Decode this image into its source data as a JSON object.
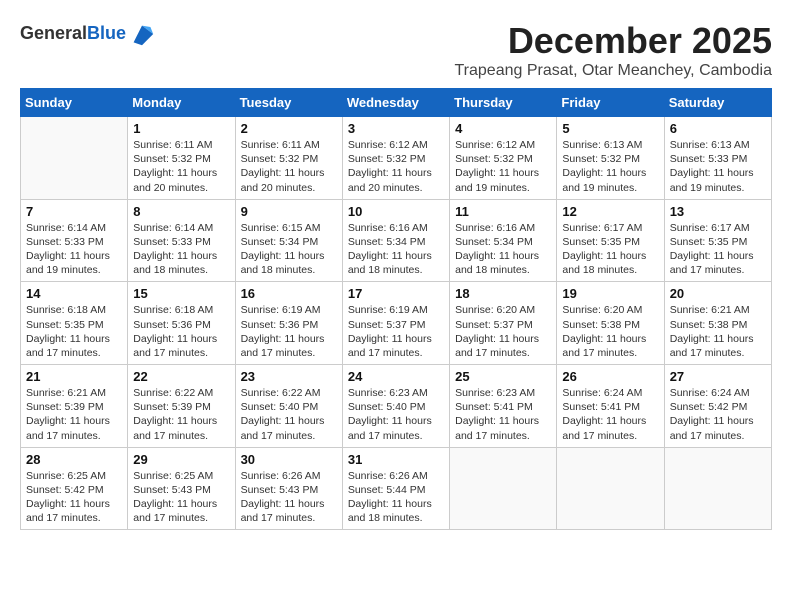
{
  "header": {
    "logo_general": "General",
    "logo_blue": "Blue",
    "month_title": "December 2025",
    "location": "Trapeang Prasat, Otar Meanchey, Cambodia"
  },
  "weekdays": [
    "Sunday",
    "Monday",
    "Tuesday",
    "Wednesday",
    "Thursday",
    "Friday",
    "Saturday"
  ],
  "weeks": [
    [
      {
        "day": "",
        "info": ""
      },
      {
        "day": "1",
        "info": "Sunrise: 6:11 AM\nSunset: 5:32 PM\nDaylight: 11 hours\nand 20 minutes."
      },
      {
        "day": "2",
        "info": "Sunrise: 6:11 AM\nSunset: 5:32 PM\nDaylight: 11 hours\nand 20 minutes."
      },
      {
        "day": "3",
        "info": "Sunrise: 6:12 AM\nSunset: 5:32 PM\nDaylight: 11 hours\nand 20 minutes."
      },
      {
        "day": "4",
        "info": "Sunrise: 6:12 AM\nSunset: 5:32 PM\nDaylight: 11 hours\nand 19 minutes."
      },
      {
        "day": "5",
        "info": "Sunrise: 6:13 AM\nSunset: 5:32 PM\nDaylight: 11 hours\nand 19 minutes."
      },
      {
        "day": "6",
        "info": "Sunrise: 6:13 AM\nSunset: 5:33 PM\nDaylight: 11 hours\nand 19 minutes."
      }
    ],
    [
      {
        "day": "7",
        "info": "Sunrise: 6:14 AM\nSunset: 5:33 PM\nDaylight: 11 hours\nand 19 minutes."
      },
      {
        "day": "8",
        "info": "Sunrise: 6:14 AM\nSunset: 5:33 PM\nDaylight: 11 hours\nand 18 minutes."
      },
      {
        "day": "9",
        "info": "Sunrise: 6:15 AM\nSunset: 5:34 PM\nDaylight: 11 hours\nand 18 minutes."
      },
      {
        "day": "10",
        "info": "Sunrise: 6:16 AM\nSunset: 5:34 PM\nDaylight: 11 hours\nand 18 minutes."
      },
      {
        "day": "11",
        "info": "Sunrise: 6:16 AM\nSunset: 5:34 PM\nDaylight: 11 hours\nand 18 minutes."
      },
      {
        "day": "12",
        "info": "Sunrise: 6:17 AM\nSunset: 5:35 PM\nDaylight: 11 hours\nand 18 minutes."
      },
      {
        "day": "13",
        "info": "Sunrise: 6:17 AM\nSunset: 5:35 PM\nDaylight: 11 hours\nand 17 minutes."
      }
    ],
    [
      {
        "day": "14",
        "info": "Sunrise: 6:18 AM\nSunset: 5:35 PM\nDaylight: 11 hours\nand 17 minutes."
      },
      {
        "day": "15",
        "info": "Sunrise: 6:18 AM\nSunset: 5:36 PM\nDaylight: 11 hours\nand 17 minutes."
      },
      {
        "day": "16",
        "info": "Sunrise: 6:19 AM\nSunset: 5:36 PM\nDaylight: 11 hours\nand 17 minutes."
      },
      {
        "day": "17",
        "info": "Sunrise: 6:19 AM\nSunset: 5:37 PM\nDaylight: 11 hours\nand 17 minutes."
      },
      {
        "day": "18",
        "info": "Sunrise: 6:20 AM\nSunset: 5:37 PM\nDaylight: 11 hours\nand 17 minutes."
      },
      {
        "day": "19",
        "info": "Sunrise: 6:20 AM\nSunset: 5:38 PM\nDaylight: 11 hours\nand 17 minutes."
      },
      {
        "day": "20",
        "info": "Sunrise: 6:21 AM\nSunset: 5:38 PM\nDaylight: 11 hours\nand 17 minutes."
      }
    ],
    [
      {
        "day": "21",
        "info": "Sunrise: 6:21 AM\nSunset: 5:39 PM\nDaylight: 11 hours\nand 17 minutes."
      },
      {
        "day": "22",
        "info": "Sunrise: 6:22 AM\nSunset: 5:39 PM\nDaylight: 11 hours\nand 17 minutes."
      },
      {
        "day": "23",
        "info": "Sunrise: 6:22 AM\nSunset: 5:40 PM\nDaylight: 11 hours\nand 17 minutes."
      },
      {
        "day": "24",
        "info": "Sunrise: 6:23 AM\nSunset: 5:40 PM\nDaylight: 11 hours\nand 17 minutes."
      },
      {
        "day": "25",
        "info": "Sunrise: 6:23 AM\nSunset: 5:41 PM\nDaylight: 11 hours\nand 17 minutes."
      },
      {
        "day": "26",
        "info": "Sunrise: 6:24 AM\nSunset: 5:41 PM\nDaylight: 11 hours\nand 17 minutes."
      },
      {
        "day": "27",
        "info": "Sunrise: 6:24 AM\nSunset: 5:42 PM\nDaylight: 11 hours\nand 17 minutes."
      }
    ],
    [
      {
        "day": "28",
        "info": "Sunrise: 6:25 AM\nSunset: 5:42 PM\nDaylight: 11 hours\nand 17 minutes."
      },
      {
        "day": "29",
        "info": "Sunrise: 6:25 AM\nSunset: 5:43 PM\nDaylight: 11 hours\nand 17 minutes."
      },
      {
        "day": "30",
        "info": "Sunrise: 6:26 AM\nSunset: 5:43 PM\nDaylight: 11 hours\nand 17 minutes."
      },
      {
        "day": "31",
        "info": "Sunrise: 6:26 AM\nSunset: 5:44 PM\nDaylight: 11 hours\nand 18 minutes."
      },
      {
        "day": "",
        "info": ""
      },
      {
        "day": "",
        "info": ""
      },
      {
        "day": "",
        "info": ""
      }
    ]
  ]
}
